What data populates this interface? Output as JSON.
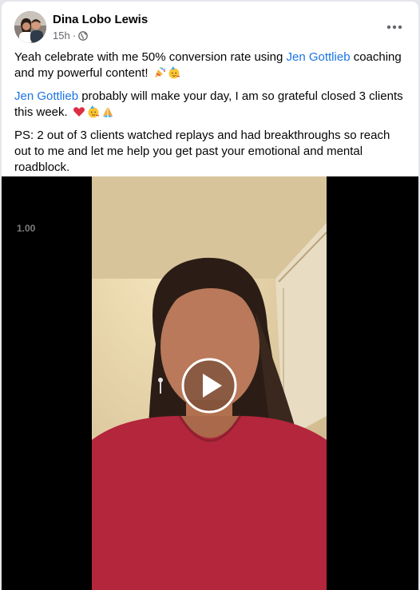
{
  "post": {
    "author": "Dina Lobo Lewis",
    "time": "15h",
    "separator": "·",
    "privacy_icon": "globe-icon",
    "more_icon": "more-options-icon",
    "paragraph1": {
      "before": "Yeah celebrate with me 50% conversion rate using ",
      "link": "Jen Gottlieb",
      "after": " coaching and my powerful content! ",
      "emojis": [
        "party-popper-emoji",
        "partying-face-emoji"
      ]
    },
    "paragraph2": {
      "link": "Jen Gottlieb",
      "after": " probably will make your day, I am so grateful closed 3 clients this week. ",
      "emojis": [
        "red-heart-emoji",
        "partying-face-emoji",
        "folded-hands-emoji"
      ]
    },
    "paragraph3": "PS: 2 out of 3 clients watched replays and had breakthroughs so reach out to me and let me help you get past your emotional and mental roadblock."
  },
  "video": {
    "speed_label": "1.00",
    "play_icon": "play-icon",
    "colors": {
      "background": "#000000",
      "wall": "#e9d9b0",
      "shirt": "#b3263c",
      "hair": "#2b1d16"
    }
  },
  "colors": {
    "link": "#1b74e4",
    "secondary_text": "#65676b",
    "page_bg": "#e4e6eb"
  }
}
